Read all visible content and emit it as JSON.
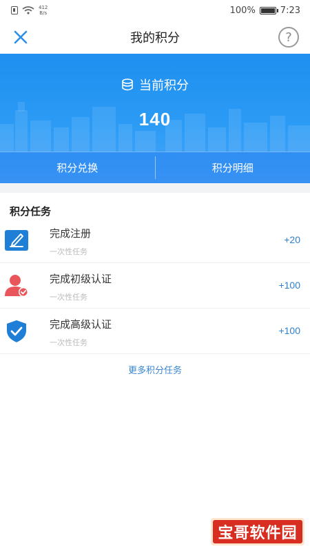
{
  "status_bar": {
    "network_speed_top": "412",
    "network_speed_unit": "B/s",
    "battery": "100%",
    "battery_level": 1.0,
    "time": "7:23"
  },
  "header": {
    "title": "我的积分",
    "help_glyph": "?"
  },
  "banner": {
    "points_label": "当前积分",
    "points_value": "140",
    "exchange_label": "积分兑换",
    "details_label": "积分明细",
    "gradient_start": "#1f8ff0",
    "gradient_end": "#4aa6f7"
  },
  "tasks": {
    "section_title": "积分任务",
    "items": [
      {
        "name": "完成注册",
        "subtitle": "一次性任务",
        "reward": "+20",
        "icon": "register-edit-icon"
      },
      {
        "name": "完成初级认证",
        "subtitle": "一次性任务",
        "reward": "+100",
        "icon": "user-verify-icon"
      },
      {
        "name": "完成高级认证",
        "subtitle": "一次性任务",
        "reward": "+100",
        "icon": "shield-check-icon"
      }
    ],
    "more_label": "更多积分任务"
  },
  "watermark": {
    "text": "宝哥软件园",
    "color": "#d72e21"
  },
  "colors": {
    "accent": "#2b9bf5",
    "reward_text": "#2d7fd0"
  }
}
